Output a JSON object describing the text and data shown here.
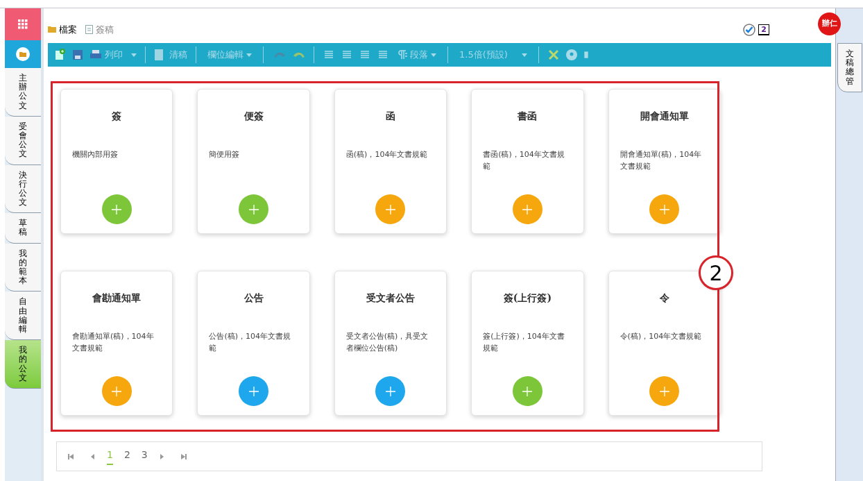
{
  "breadcrumb": [
    {
      "label": "檔案",
      "kind": "folder"
    },
    {
      "label": "簽稿",
      "kind": "document"
    }
  ],
  "status": {
    "count": "2"
  },
  "user": {
    "initials": "辦仁"
  },
  "toolbar": {
    "print": "列印",
    "clean": "清稿",
    "fields": "欄位編輯",
    "paragraph": "段落",
    "spacing": "1.5倍(預設)"
  },
  "side_tabs": [
    {
      "label": "主辦公文",
      "selected": false
    },
    {
      "label": "受會公文",
      "selected": false
    },
    {
      "label": "決行公文",
      "selected": false
    },
    {
      "label": "草稿",
      "selected": false
    },
    {
      "label": "我的範本",
      "selected": false
    },
    {
      "label": "自由編輯",
      "selected": false
    },
    {
      "label": "我的公文",
      "selected": true
    }
  ],
  "right_tab": {
    "label": "文稿總管"
  },
  "cards": [
    {
      "title": "簽",
      "description": "機關內部用簽",
      "color": "#7dc63a"
    },
    {
      "title": "便簽",
      "description": "簡便用簽",
      "color": "#7dc63a"
    },
    {
      "title": "函",
      "description": "函(稿)，104年文書規範",
      "color": "#f5a70d"
    },
    {
      "title": "書函",
      "description": "書函(稿)，104年文書規範",
      "color": "#f5a70d"
    },
    {
      "title": "開會通知單",
      "description": "開會通知單(稿)，104年文書規範",
      "color": "#f5a70d"
    },
    {
      "title": "會勘通知單",
      "description": "會勘通知單(稿)，104年文書規範",
      "color": "#f5a70d"
    },
    {
      "title": "公告",
      "description": "公告(稿)，104年文書規範",
      "color": "#1ea7ec"
    },
    {
      "title": "受文者公告",
      "description": "受文者公告(稿)，具受文者欄位公告(稿)",
      "color": "#1ea7ec"
    },
    {
      "title": "簽(上行簽)",
      "description": "簽(上行簽)，104年文書規範",
      "color": "#7dc63a"
    },
    {
      "title": "令",
      "description": "令(稿)，104年文書規範",
      "color": "#f5a70d"
    }
  ],
  "annotation": {
    "label": "2"
  },
  "pagination": [
    {
      "label": "1",
      "selected": true
    },
    {
      "label": "2",
      "selected": false
    },
    {
      "label": "3",
      "selected": false
    }
  ]
}
